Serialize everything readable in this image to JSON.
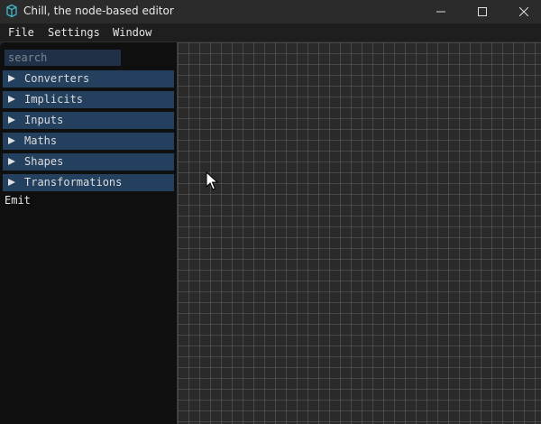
{
  "window": {
    "title": "Chill, the node-based editor",
    "icon": "cube-icon"
  },
  "menu": {
    "items": [
      "File",
      "Settings",
      "Window"
    ]
  },
  "sidebar": {
    "search_placeholder": "search",
    "categories": [
      "Converters",
      "Implicits",
      "Inputs",
      "Maths",
      "Shapes",
      "Transformations"
    ],
    "emit_label": "Emit"
  },
  "colors": {
    "accent": "#24405f",
    "search_bg": "#1f3047",
    "canvas_bg": "#2a2a2a"
  }
}
